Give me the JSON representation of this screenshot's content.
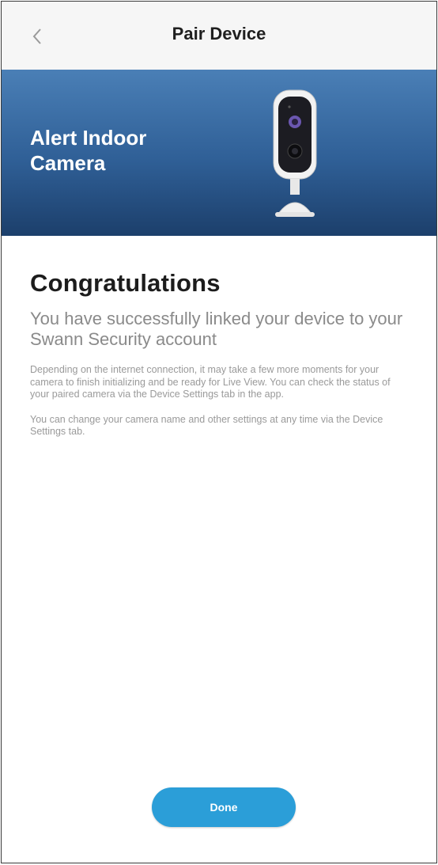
{
  "header": {
    "title": "Pair Device",
    "back_icon": "chevron-left-icon"
  },
  "banner": {
    "device_name": "Alert Indoor Camera",
    "image_icon": "security-camera-icon"
  },
  "main": {
    "heading": "Congratulations",
    "subtitle": "You have successfully linked your device to your Swann Security account",
    "paragraph_1": "Depending on the internet connection, it may take a few more moments for your camera to finish initializing and be ready for Live View. You can check the status of your paired camera via the Device Settings tab in the app.",
    "paragraph_2": "You can change your camera name and other settings at any time via the Device Settings tab."
  },
  "footer": {
    "done_label": "Done"
  },
  "colors": {
    "banner_top": "#4a7fb6",
    "banner_bottom": "#1c3f6b",
    "button": "#2b9ed8"
  }
}
